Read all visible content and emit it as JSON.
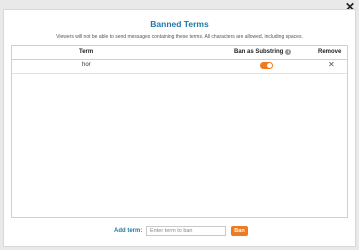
{
  "modal": {
    "title": "Banned Terms",
    "subtitle": "Viewers will not be able to send messages containing these terms. All characters are allowed, including spaces."
  },
  "table": {
    "columns": {
      "term": "Term",
      "ban_as_substring": "Ban as Substring",
      "remove": "Remove"
    },
    "rows": [
      {
        "term": "hor",
        "ban_as_substring": true
      }
    ]
  },
  "footer": {
    "add_label": "Add term:",
    "input_placeholder": "Enter term to ban",
    "input_value": "",
    "ban_button": "Ban"
  },
  "icons": {
    "close": "close-icon",
    "info": "info-icon",
    "remove": "remove-icon",
    "toggle": "toggle-switch"
  },
  "colors": {
    "accent": "#ee7b1f",
    "title": "#1f79a8"
  }
}
